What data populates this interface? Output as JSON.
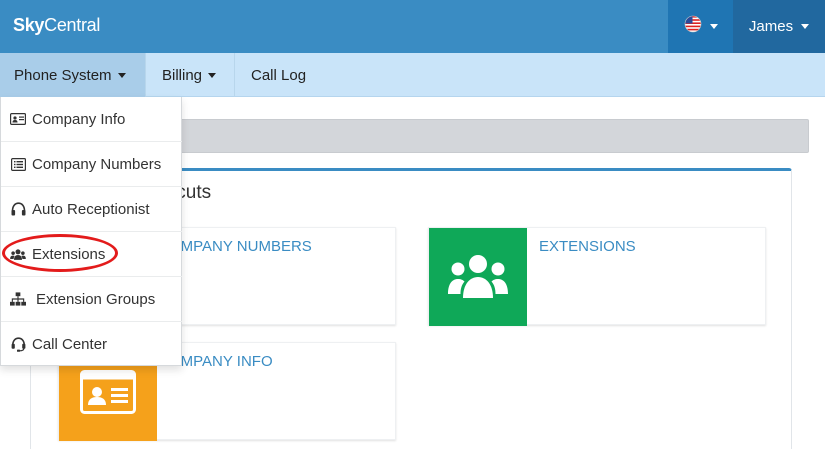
{
  "app": {
    "brand_bold": "Sky",
    "brand_rest": "Central",
    "locale_flag": "us-flag-icon",
    "user_name": "James"
  },
  "nav": {
    "items": [
      {
        "label": "Phone System",
        "has_caret": true,
        "active": true
      },
      {
        "label": "Billing",
        "has_caret": true
      },
      {
        "label": "Call Log"
      }
    ]
  },
  "dropdown": {
    "items": [
      {
        "label": "Company Info",
        "icon": "id-card-icon"
      },
      {
        "label": "Company Numbers",
        "icon": "list-icon"
      },
      {
        "label": "Auto Receptionist",
        "icon": "headphones-icon"
      },
      {
        "label": "Extensions",
        "icon": "users-icon",
        "highlighted": true
      },
      {
        "label": "Extension Groups",
        "icon": "sitemap-icon"
      },
      {
        "label": "Call Center",
        "icon": "headset-icon"
      }
    ]
  },
  "main": {
    "panel_title": "tcuts",
    "shortcuts": [
      {
        "label": "OMPANY NUMBERS"
      },
      {
        "label": "EXTENSIONS",
        "icon": "users-icon",
        "tile_color": "#0fa858"
      },
      {
        "label": "OMPANY INFO",
        "icon": "id-card-icon",
        "tile_color": "#f5a11b"
      }
    ]
  },
  "colors": {
    "topbar": "#3a8cc3",
    "subnav": "#c9e4f9",
    "highlight": "#e31b1b"
  }
}
